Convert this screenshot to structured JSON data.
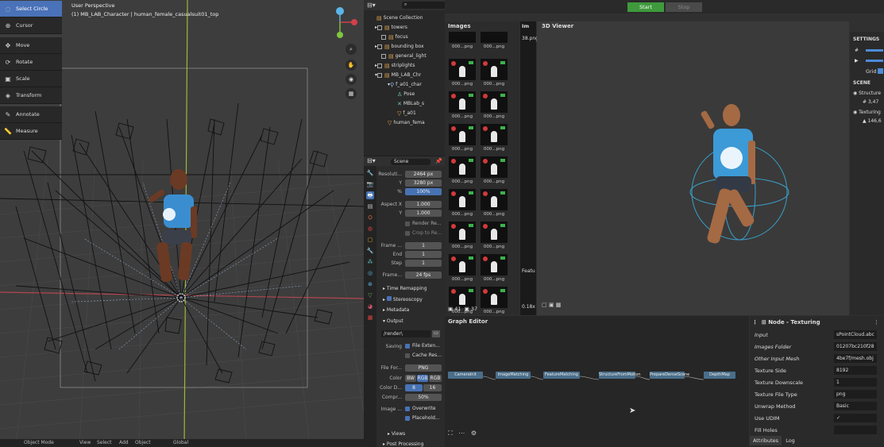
{
  "viewport": {
    "title": "User Perspective",
    "subtitle": "(1) MB_LAB_Character | human_female_casualsuit01_top",
    "tools": [
      "Select Circle",
      "Cursor",
      "Move",
      "Rotate",
      "Scale",
      "Transform",
      "Annotate",
      "Measure"
    ],
    "bottom_bar": [
      "Object Mode",
      "View",
      "Select",
      "Add",
      "Object",
      "Global"
    ],
    "accent": "#4772b3"
  },
  "outliner": {
    "header": "Scene Collection",
    "items": [
      "towers",
      "focus",
      "bounding box",
      "general_light",
      "striplights",
      "MB_LAB_Chr",
      "f_a01_char",
      "Pose",
      "MBLab_s",
      "f_a01",
      "human_fema"
    ]
  },
  "properties": {
    "header": "Scene",
    "resolution_label": "Resoluti...",
    "res_x_label": "X",
    "res_x": "2464 px",
    "res_y_label": "Y",
    "res_y": "3280 px",
    "res_pct_label": "%",
    "res_pct": "100%",
    "aspect_label": "Aspect X",
    "aspect_x": "1.000",
    "aspect_y_label": "Y",
    "aspect_y": "1.000",
    "render_region": "Render Re...",
    "crop": "Crop to Re...",
    "frame_start_label": "Frame ...",
    "frame_start": "1",
    "frame_end_label": "End",
    "frame_end": "1",
    "frame_step_label": "Step",
    "frame_step": "1",
    "frame_rate_label": "Frame...",
    "frame_rate": "24 fps",
    "time_remapping": "Time Remapping",
    "stereoscopy": "Stereoscopy",
    "metadata": "Metadata",
    "output": "Output",
    "output_path": "/render\\",
    "saving_label": "Saving",
    "file_ext": "File Exten...",
    "cache_result": "Cache Res...",
    "file_format_label": "File For...",
    "file_format": "PNG",
    "color_label": "Color",
    "color_bw": "BW",
    "color_rgb": "RGB",
    "color_rgba": "RGB",
    "color_depth_label": "Color D...",
    "depth_8": "8",
    "depth_16": "16",
    "compression_label": "Compr...",
    "compression": "50%",
    "image_seq_label": "Image ...",
    "overwrite": "Overwrite",
    "placeholders": "Placehold...",
    "views": "Views",
    "post_processing": "Post Processing"
  },
  "meshroom": {
    "start": "Start",
    "stop": "Stop",
    "images_title": "Images",
    "image_label": "000...png",
    "images_count": "41",
    "images_count2": "37",
    "im_title": "Im",
    "im_file": "38.png",
    "im_zoom": "0.18x",
    "im_features": "Featu",
    "viewer_title": "3D Viewer",
    "graph_title": "Graph Editor",
    "nodes": [
      "CameraInit",
      "FeatureExtraction",
      "ImageMatching",
      "FeatureMatching",
      "StructureFromMotion",
      "PrepareDenseScene",
      "DepthMap"
    ],
    "settings_title": "SETTINGS",
    "grid_label": "Grid",
    "scene_title": "SCENE",
    "structure_label": "Structure",
    "structure_value": "3,47",
    "texturing_label": "Texturing",
    "texturing_value": "146,6",
    "node_editor_title": "Node - Texturing",
    "params": [
      {
        "k": "Input",
        "v": "sPointCloud.abc"
      },
      {
        "k": "Images Folder",
        "v": "01207bc210f28"
      },
      {
        "k": "Other Input Mesh",
        "v": "4be7f/mesh.obj"
      },
      {
        "k": "Texture Side",
        "v": "8192"
      },
      {
        "k": "Texture Downscale",
        "v": "1"
      },
      {
        "k": "Texture File Type",
        "v": "png"
      },
      {
        "k": "Unwrap Method",
        "v": "Basic"
      },
      {
        "k": "Use UDIM",
        "v": "✓"
      },
      {
        "k": "Fill Holes",
        "v": ""
      }
    ],
    "tab_attributes": "Attributes",
    "tab_log": "Log",
    "start_color": "#3e9a3c"
  }
}
